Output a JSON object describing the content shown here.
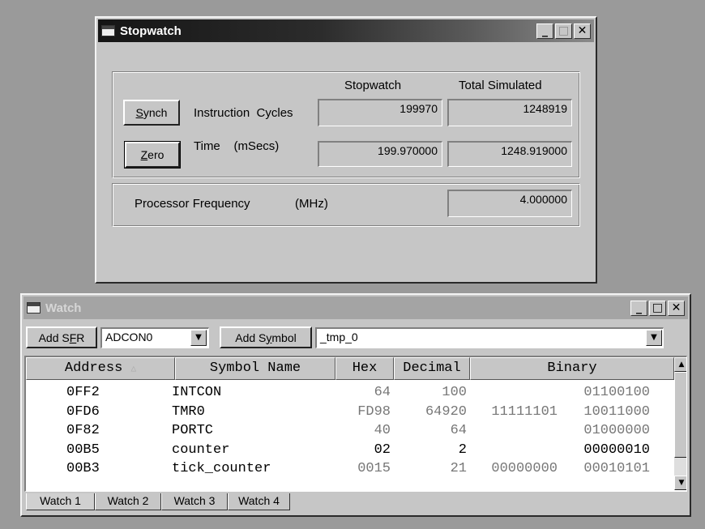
{
  "stopwatch": {
    "title": "Stopwatch",
    "col_stopwatch": "Stopwatch",
    "col_total": "Total Simulated",
    "synch_pre": "",
    "synch_u": "S",
    "synch_post": "ynch",
    "zero_u": "Z",
    "zero_post": "ero",
    "instr_label": "Instruction  Cycles",
    "instr_stopwatch": "199970",
    "instr_total": "1248919",
    "time_label": "Time    (mSecs)",
    "time_stopwatch": "199.970000",
    "time_total": "1248.919000",
    "freq_label": "Processor Frequency",
    "freq_unit": "(MHz)",
    "freq_value": "4.000000"
  },
  "watch": {
    "title": "Watch",
    "add_sfr_pre": "Add S",
    "add_sfr_u": "F",
    "add_sfr_post": "R",
    "sfr_select": "ADCON0",
    "add_symbol_pre": "Add S",
    "add_symbol_u": "y",
    "add_symbol_post": "mbol",
    "symbol_select": "_tmp_0",
    "columns": {
      "address": "Address",
      "symbol": "Symbol Name",
      "hex": "Hex",
      "decimal": "Decimal",
      "binary": "Binary"
    },
    "rows": [
      {
        "address": "0FF2",
        "symbol": "INTCON",
        "hex": "64",
        "decimal": "100",
        "binary_hi": "",
        "binary_lo": "01100100",
        "changed": false
      },
      {
        "address": "0FD6",
        "symbol": "TMR0",
        "hex": "FD98",
        "decimal": "64920",
        "binary_hi": "11111101",
        "binary_lo": "10011000",
        "changed": false
      },
      {
        "address": "0F82",
        "symbol": "PORTC",
        "hex": "40",
        "decimal": "64",
        "binary_hi": "",
        "binary_lo": "01000000",
        "changed": false
      },
      {
        "address": "00B5",
        "symbol": "counter",
        "hex": "02",
        "decimal": "2",
        "binary_hi": "",
        "binary_lo": "00000010",
        "changed": true
      },
      {
        "address": "00B3",
        "symbol": "tick_counter",
        "hex": "0015",
        "decimal": "21",
        "binary_hi": "00000000",
        "binary_lo": "00010101",
        "changed": false
      }
    ],
    "tabs": [
      "Watch 1",
      "Watch 2",
      "Watch 3",
      "Watch 4"
    ]
  },
  "colors": {
    "changed_value": "#000000",
    "unchanged_value": "#777777"
  }
}
